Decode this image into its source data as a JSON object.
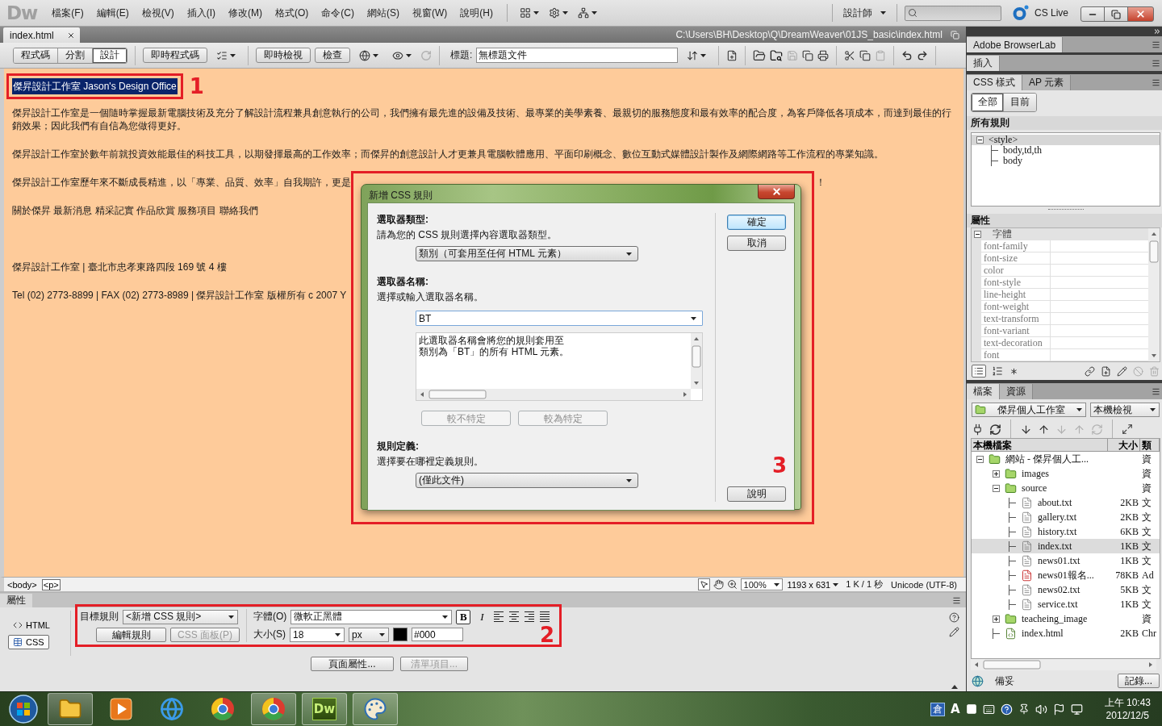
{
  "menu_bar": {
    "logo": "Dw",
    "menus": [
      "檔案(F)",
      "編輯(E)",
      "檢視(V)",
      "插入(I)",
      "修改(M)",
      "格式(O)",
      "命令(C)",
      "網站(S)",
      "視窗(W)",
      "說明(H)"
    ],
    "workspace": "設計師",
    "cs_live": "CS Live"
  },
  "document_tab": {
    "label": "index.html",
    "path": "C:\\Users\\BH\\Desktop\\Q\\DreamWeaver\\01JS_basic\\index.html"
  },
  "doc_toolbar": {
    "views": [
      {
        "label": "程式碼",
        "selected": false
      },
      {
        "label": "分割",
        "selected": false
      },
      {
        "label": "設計",
        "selected": true
      }
    ],
    "live_code": "即時程式碼",
    "live_view": "即時檢視",
    "inspect": "檢查",
    "title_label": "標題:",
    "title_value": "無標題文件"
  },
  "document": {
    "heading": {
      "text": "傑昇設計工作室 Jason's Design Office",
      "selected": true,
      "annotation": "1"
    },
    "paragraphs": [
      {
        "text": "傑昇設計工作室是一個隨時掌握最新電腦技術及充分了解設計流程兼具創意執行的公司，我們擁有最先進的設備及技術、最專業的美學素養、最親切的服務態度和最有效率的配合度，為客戶降低各項成本，而達到最佳的行銷效果；因此我們有自信為您做得更好。"
      },
      {
        "text": "傑昇設計工作室於數年前就投資效能最佳的科技工具，以期發揮最高的工作效率；而傑昇的創意設計人才更兼具電腦軟體應用、平面印刷概念、數位互動式媒體設計製作及網際網路等工作流程的專業知識。"
      },
      {
        "text": "傑昇設計工作室歷年來不斷成長精進，以「專業、品質、效率」自我期許，更是",
        "tail": "！"
      },
      {
        "text": "關於傑昇 最新消息 精采記實 作品欣賞 服務項目 聯絡我們"
      }
    ],
    "footer": [
      "傑昇設計工作室 | 臺北市忠孝東路四段 169 號 4 樓",
      "Tel (02) 2773-8899 | FAX (02) 2773-8989 | 傑昇設計工作室 版權所有 c 2007 Y"
    ]
  },
  "dialog": {
    "title": "新增 CSS 規則",
    "annotation": "3",
    "sections": [
      {
        "kind": "select",
        "heading": "選取器類型:",
        "hint": "請為您的 CSS 規則選擇內容選取器類型。",
        "value": "類別（可套用至任何 HTML 元素）"
      },
      {
        "kind": "combo",
        "heading": "選取器名稱:",
        "hint": "選擇或輸入選取器名稱。",
        "value": "BT",
        "description": [
          "此選取器名稱會將您的規則套用至",
          "類別為「BT」的所有 HTML 元素。"
        ],
        "buttons": [
          {
            "label": "較不特定",
            "disabled": true
          },
          {
            "label": "較為特定",
            "disabled": true
          }
        ]
      },
      {
        "kind": "select",
        "heading": "規則定義:",
        "hint": "選擇要在哪裡定義規則。",
        "value": "(僅此文件)"
      }
    ],
    "buttons": [
      {
        "label": "確定",
        "default": true
      },
      {
        "label": "取消",
        "default": false
      }
    ],
    "help": "說明"
  },
  "status_bar": {
    "tags": [
      {
        "label": "<body>",
        "selected": false
      },
      {
        "label": "<p>",
        "selected": true
      }
    ],
    "zoom": "100%",
    "dimensions": "1193 x 631",
    "download": "1 K / 1 秒",
    "encoding": "Unicode (UTF-8)"
  },
  "properties": {
    "title": "屬性",
    "modes": [
      {
        "kind": "html",
        "label": "HTML",
        "selected": false
      },
      {
        "kind": "css",
        "label": "CSS",
        "selected": true
      }
    ],
    "annotation": "2",
    "target_rule_label": "目標規則",
    "target_rule": "<新增 CSS 規則>",
    "edit_rule": "編輯規則",
    "css_panel": {
      "label": "CSS 面板(P)",
      "disabled": true
    },
    "font_label": "字體(O)",
    "font": "微軟正黑體",
    "bold": {
      "label": "B",
      "on": true
    },
    "italic": {
      "label": "I",
      "on": false
    },
    "size_label": "大小(S)",
    "size": "18",
    "unit": "px",
    "color": "#000",
    "page_properties": "頁面屬性...",
    "list_item": {
      "label": "清單項目...",
      "disabled": true
    }
  },
  "panels": {
    "browserlab": "Adobe BrowserLab",
    "insert": "插入",
    "css": {
      "tabs": [
        {
          "label": "CSS 樣式",
          "selected": true
        },
        {
          "label": "AP 元素",
          "selected": false
        }
      ],
      "modes": [
        {
          "label": "全部",
          "selected": true
        },
        {
          "label": "目前",
          "selected": false
        }
      ],
      "rules_heading": "所有規則",
      "rules": [
        {
          "label": "<style>",
          "selected": true,
          "expanded": true,
          "children": [
            {
              "label": "body,td,th",
              "selected": false
            },
            {
              "label": "body",
              "selected": false
            }
          ]
        }
      ],
      "properties_heading": "屬性",
      "category": {
        "label": "字體",
        "expanded": true
      },
      "properties": [
        "font-family",
        "font-size",
        "color",
        "font-style",
        "line-height",
        "font-weight",
        "text-transform",
        "font-variant",
        "text-decoration",
        "font"
      ]
    },
    "files": {
      "tabs": [
        {
          "label": "檔案",
          "selected": true
        },
        {
          "label": "資源",
          "selected": false
        }
      ],
      "site": "傑昇個人工作室",
      "view": "本機檢視",
      "columns": [
        "本機檔案",
        "大小",
        "類"
      ],
      "tree": [
        {
          "name": "網站 - 傑昇個人工...",
          "kind": "site",
          "type": "資",
          "selected": false,
          "expanded": true,
          "children": [
            {
              "name": "images",
              "kind": "folder",
              "type": "資",
              "selected": false,
              "expanded": false
            },
            {
              "name": "source",
              "kind": "folder",
              "type": "資",
              "selected": false,
              "expanded": true,
              "children": [
                {
                  "name": "about.txt",
                  "kind": "text",
                  "size": "2KB",
                  "type": "文",
                  "selected": false
                },
                {
                  "name": "gallery.txt",
                  "kind": "text",
                  "size": "2KB",
                  "type": "文",
                  "selected": false
                },
                {
                  "name": "history.txt",
                  "kind": "text",
                  "size": "6KB",
                  "type": "文",
                  "selected": false
                },
                {
                  "name": "index.txt",
                  "kind": "text",
                  "size": "1KB",
                  "type": "文",
                  "selected": true
                },
                {
                  "name": "news01.txt",
                  "kind": "text",
                  "size": "1KB",
                  "type": "文",
                  "selected": false
                },
                {
                  "name": "news01報名...",
                  "kind": "pdf",
                  "size": "78KB",
                  "type": "Ad",
                  "selected": false
                },
                {
                  "name": "news02.txt",
                  "kind": "text",
                  "size": "5KB",
                  "type": "文",
                  "selected": false
                },
                {
                  "name": "service.txt",
                  "kind": "text",
                  "size": "1KB",
                  "type": "文",
                  "selected": false
                }
              ]
            },
            {
              "name": "teacheing_image",
              "kind": "folder",
              "type": "資",
              "selected": false,
              "expanded": false
            },
            {
              "name": "index.html",
              "kind": "html",
              "size": "2KB",
              "type": "Chr",
              "selected": false
            }
          ]
        }
      ],
      "status": "備妥",
      "log": "記錄..."
    }
  },
  "taskbar": {
    "apps": [
      {
        "kind": "explorer",
        "running": true
      },
      {
        "kind": "media",
        "running": false
      },
      {
        "kind": "ie",
        "running": false
      },
      {
        "kind": "chrome",
        "running": false
      },
      {
        "kind": "chrome",
        "running": true
      },
      {
        "kind": "dw",
        "label": "Dw",
        "running": true
      },
      {
        "kind": "paint",
        "running": true
      }
    ],
    "ime": "倉",
    "ime_mode": "A",
    "time": "上午 10:43",
    "date": "2012/12/5"
  }
}
